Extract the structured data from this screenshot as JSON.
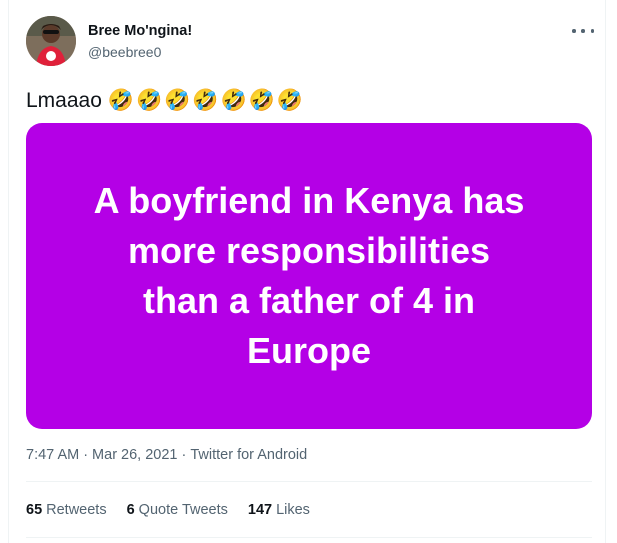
{
  "user": {
    "display_name": "Bree Mo'ngina!",
    "handle": "@beebree0"
  },
  "tweet": {
    "text": "Lmaaao",
    "emojis": [
      "🤣",
      "🤣",
      "🤣",
      "🤣",
      "🤣",
      "🤣",
      "🤣"
    ],
    "image_text": "A boyfriend in Kenya has\nmore responsibilities\nthan a father of 4 in\nEurope",
    "image_color": "#b400e6"
  },
  "meta": {
    "time": "7:47 AM",
    "sep1": "·",
    "date": "Mar 26, 2021",
    "sep2": "·",
    "source": "Twitter for Android"
  },
  "stats": {
    "retweets_count": "65",
    "retweets_label": "Retweets",
    "quotes_count": "6",
    "quotes_label": "Quote Tweets",
    "likes_count": "147",
    "likes_label": "Likes"
  },
  "icons": {
    "more": "more-horizontal-icon",
    "emoji": "rolling-on-floor-laughing-emoji"
  }
}
